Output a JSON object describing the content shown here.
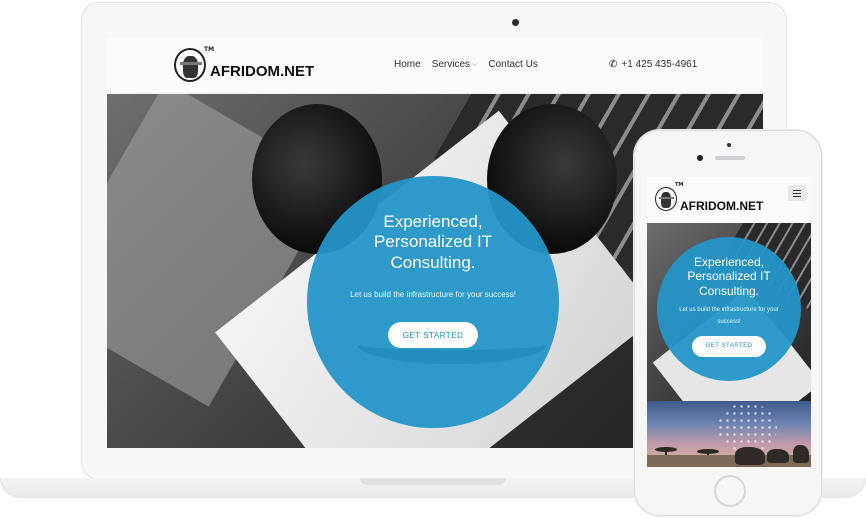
{
  "site": {
    "logo_text": "AFRIDOM.NET",
    "logo_tm": "TM"
  },
  "nav": {
    "items": [
      {
        "label": "Home"
      },
      {
        "label": "Services"
      },
      {
        "label": "Contact Us"
      }
    ],
    "phone": "+1 425 435-4961"
  },
  "hero": {
    "heading": "Experienced, Personalized IT Consulting.",
    "subtext": "Let us build the infrastructure for your success!",
    "cta_label": "GET STARTED"
  },
  "colors": {
    "accent": "#2496c7",
    "cta_text": "#2496c7"
  },
  "icons": {
    "phone": "phone-icon",
    "menu": "hamburger-menu-icon",
    "dropdown": "chevron-down-icon"
  }
}
